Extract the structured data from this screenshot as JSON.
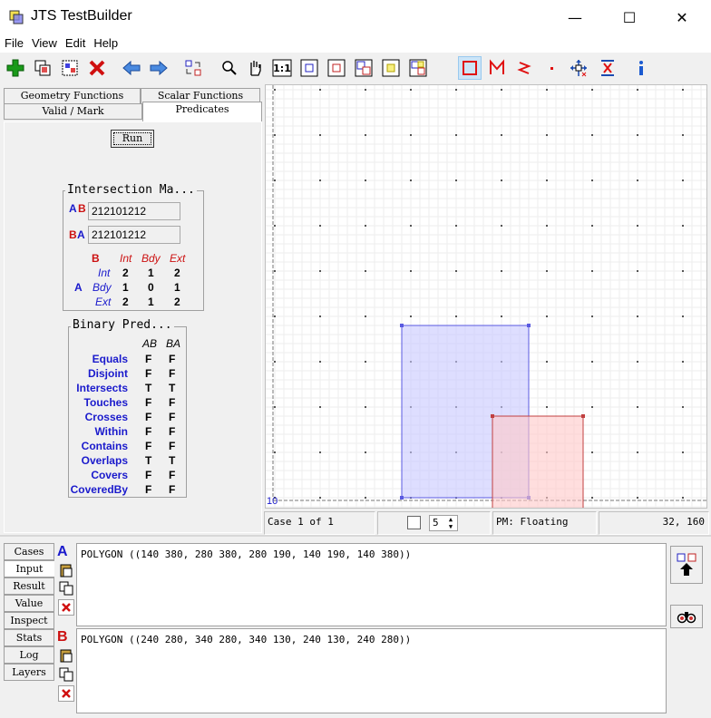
{
  "window": {
    "title": "JTS TestBuilder",
    "minimize": "—",
    "maximize": "☐",
    "close": "✕"
  },
  "menu": [
    "File",
    "View",
    "Edit",
    "Help"
  ],
  "tabs": {
    "geometry_functions": "Geometry Functions",
    "scalar_functions": "Scalar Functions",
    "valid_mark": "Valid / Mark",
    "predicates": "Predicates"
  },
  "run_label": "Run",
  "intersection_matrix": {
    "title": "Intersection Ma...",
    "ab_label_a": "A",
    "ab_label_b": "B",
    "ab_value": "212101212",
    "ba_label_b": "B",
    "ba_label_a": "A",
    "ba_value": "212101212",
    "col_b": "B",
    "cols": [
      "Int",
      "Bdy",
      "Ext"
    ],
    "row_a": "A",
    "rows": [
      {
        "label": "Int",
        "values": [
          "2",
          "1",
          "2"
        ]
      },
      {
        "label": "Bdy",
        "values": [
          "1",
          "0",
          "1"
        ]
      },
      {
        "label": "Ext",
        "values": [
          "2",
          "1",
          "2"
        ]
      }
    ]
  },
  "binary_predicates": {
    "title": "Binary Pred...",
    "col_ab": "AB",
    "col_ba": "BA",
    "rows": [
      {
        "name": "Equals",
        "ab": "F",
        "ba": "F"
      },
      {
        "name": "Disjoint",
        "ab": "F",
        "ba": "F"
      },
      {
        "name": "Intersects",
        "ab": "T",
        "ba": "T"
      },
      {
        "name": "Touches",
        "ab": "F",
        "ba": "F"
      },
      {
        "name": "Crosses",
        "ab": "F",
        "ba": "F"
      },
      {
        "name": "Within",
        "ab": "F",
        "ba": "F"
      },
      {
        "name": "Contains",
        "ab": "F",
        "ba": "F"
      },
      {
        "name": "Overlaps",
        "ab": "T",
        "ba": "T"
      },
      {
        "name": "Covers",
        "ab": "F",
        "ba": "F"
      },
      {
        "name": "CoveredBy",
        "ab": "F",
        "ba": "F"
      }
    ]
  },
  "canvas": {
    "scale_label": "10",
    "color_a": "#5a5ae0",
    "color_b": "#c04040"
  },
  "status": {
    "case": "Case 1 of 1",
    "spinner_value": "5",
    "precision": "PM: Floating",
    "coords": "32, 160"
  },
  "bottom_tabs": [
    "Cases",
    "Input",
    "Result",
    "Value",
    "Inspect",
    "Stats",
    "Log",
    "Layers"
  ],
  "input": {
    "label_a": "A",
    "geometry_a": "POLYGON ((140 380, 280 380, 280 190, 140 190, 140 380))",
    "label_b": "B",
    "geometry_b": "POLYGON ((240 280, 340 280, 340 130, 240 130, 240 280))"
  }
}
